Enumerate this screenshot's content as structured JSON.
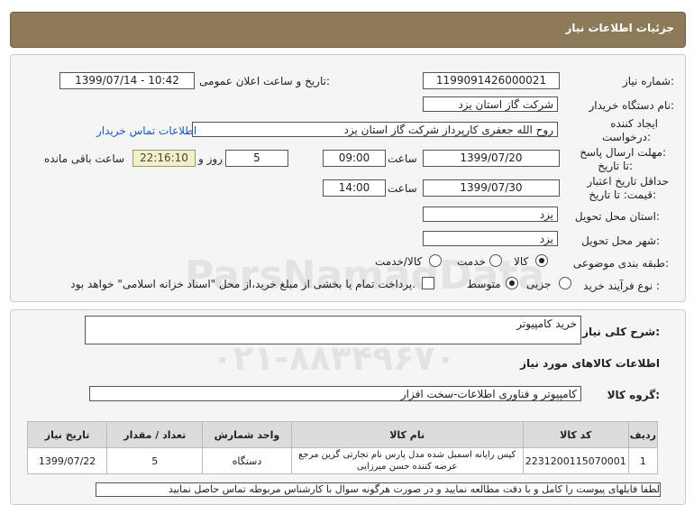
{
  "header": {
    "title": "جزئیات اطلاعات نیاز"
  },
  "form": {
    "need_number_label": "شماره نیاز:",
    "need_number": "1199091426000021",
    "announce_label": "تاریخ و ساعت اعلان عمومی:",
    "announce_value": "1399/07/14 - 10:42",
    "buyer_org_label": "نام دستگاه خریدار:",
    "buyer_org": "شرکت گاز استان یزد",
    "creator_label_1": "ایجاد کننده",
    "creator_label_2": "درخواست:",
    "creator": "روح الله جعفری کارپرداز  شرکت گاز استان یزد",
    "contact_link": "اطلاعات تماس خریدار",
    "deadline_label_1": "مهلت ارسال پاسخ:",
    "deadline_label_2": "تا تاریخ:",
    "deadline_date": "1399/07/20",
    "time_label": "ساعت",
    "deadline_time": "09:00",
    "days_value": "5",
    "days_label": "روز و",
    "remaining_time": "22:16:10",
    "remaining_label": "ساعت باقی مانده",
    "validity_label_1": "حداقل تاریخ اعتبار",
    "validity_label_2": "قیمت: تا تاریخ:",
    "validity_date": "1399/07/30",
    "validity_time": "14:00",
    "province_label": "استان محل تحویل:",
    "province": "یزد",
    "city_label": "شهر محل تحویل:",
    "city": "یزد",
    "category_label": "طبقه بندی موضوعی:",
    "cat_goods": "کالا",
    "cat_service": "خدمت",
    "cat_goods_service": "کالا/خدمت",
    "process_label": "نوع فرآیند خرید :",
    "proc_partial": "جزیی",
    "proc_medium": "متوسط",
    "payment_note": "پرداخت تمام یا بخشی از مبلغ خرید،از محل \"اسناد خزانه اسلامی\" خواهد بود."
  },
  "details": {
    "general_desc_label": "شرح کلی نیاز:",
    "general_desc": "خرید کامپیوتر",
    "goods_info_title": "اطلاعات کالاهای مورد نیاز",
    "goods_group_label": "گروه کالا:",
    "goods_group": "کامپیوتر و فناوری اطلاعات-سخت افزار"
  },
  "table": {
    "headers": [
      "ردیف",
      "کد کالا",
      "نام کالا",
      "واحد شمارش",
      "تعداد / مقدار",
      "تاریخ نیاز"
    ],
    "rows": [
      {
        "row": "1",
        "code": "2231200115070001",
        "name": "کیس رایانه اسمبل شده مدل پارس نام تجارتی گرین مرجع عرضه کننده حسن میرزایی",
        "unit": "دستگاه",
        "qty": "5",
        "date": "1399/07/22"
      }
    ]
  },
  "bottom_text": "لطفا فایلهای پیوست را کامل و با دقت مطالعه نمایید و در صورت هرگونه سوال با کارشناس مربوطه تماس حاصل نمایید"
}
